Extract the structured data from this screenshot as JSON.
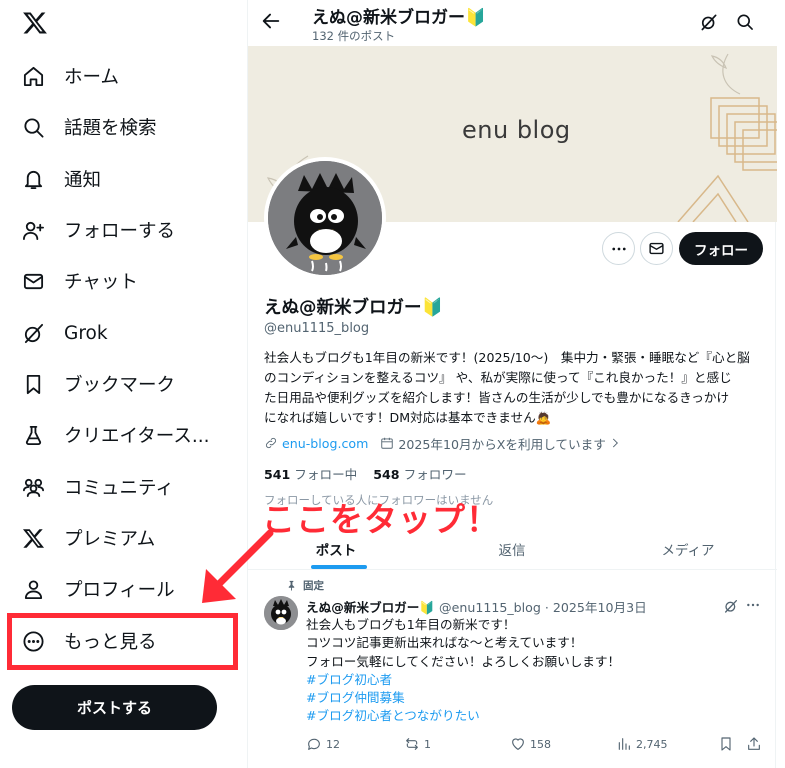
{
  "sidebar": {
    "logo": "x-logo-icon",
    "items": [
      {
        "label": "ホーム",
        "icon": "home-icon"
      },
      {
        "label": "話題を検索",
        "icon": "search-icon"
      },
      {
        "label": "通知",
        "icon": "bell-icon"
      },
      {
        "label": "フォローする",
        "icon": "follow-icon"
      },
      {
        "label": "チャット",
        "icon": "envelope-icon"
      },
      {
        "label": "Grok",
        "icon": "grok-icon"
      },
      {
        "label": "ブックマーク",
        "icon": "bookmark-icon"
      },
      {
        "label": "クリエイタース...",
        "icon": "creator-flask-icon"
      },
      {
        "label": "コミュニティ",
        "icon": "community-icon"
      },
      {
        "label": "プレミアム",
        "icon": "x-premium-icon"
      },
      {
        "label": "プロフィール",
        "icon": "person-icon"
      },
      {
        "label": "もっと見る",
        "icon": "more-circle-icon"
      }
    ],
    "post_button": "ポストする"
  },
  "header": {
    "name": "えぬ@新米ブロガー🔰",
    "post_count": "132 件のポスト"
  },
  "banner": {
    "text": "enu blog"
  },
  "profile": {
    "follow_label": "フォロー",
    "name": "えぬ@新米ブロガー🔰",
    "handle": "@enu1115_blog",
    "bio": [
      "社会人もブログも1年目の新米です！(2025/10～)　集中力・緊張・睡眠など『心と脳",
      "のコンディションを整えるコツ』 や、私が実際に使って『これ良かった！』と感じ",
      "た日用品や便利グッズを紹介します！皆さんの生活が少しでも豊かになるきっかけ",
      "になれば嬉しいです！DM対応は基本できません🙇"
    ],
    "website": "enu-blog.com",
    "joined": "2025年10月からXを利用しています",
    "following_count": "541",
    "following_label": "フォロー中",
    "followers_count": "548",
    "followers_label": "フォロワー",
    "followed_by": "フォローしている人にフォロワーはいません"
  },
  "tabs": [
    "ポスト",
    "返信",
    "メディア"
  ],
  "annotation": {
    "text": "ここをタップ！",
    "color": "#ff2b36"
  },
  "post": {
    "pinned_label": "固定",
    "name": "えぬ@新米ブロガー🔰",
    "handle_date": "@enu1115_blog · 2025年10月3日",
    "lines": [
      "社会人もブログも1年目の新米です！",
      "コツコツ記事更新出来ればな～と考えています！",
      "フォロー気軽にしてください！よろしくお願いします！"
    ],
    "hashtags": [
      "#ブログ初心者",
      "#ブログ仲間募集",
      "#ブログ初心者とつながりたい"
    ],
    "replies": "12",
    "reposts": "1",
    "likes": "158",
    "views": "2,745"
  },
  "colors": {
    "accent": "#1d9bf0",
    "text": "#0f1419",
    "muted": "#536471",
    "highlight": "#ff2b36"
  }
}
